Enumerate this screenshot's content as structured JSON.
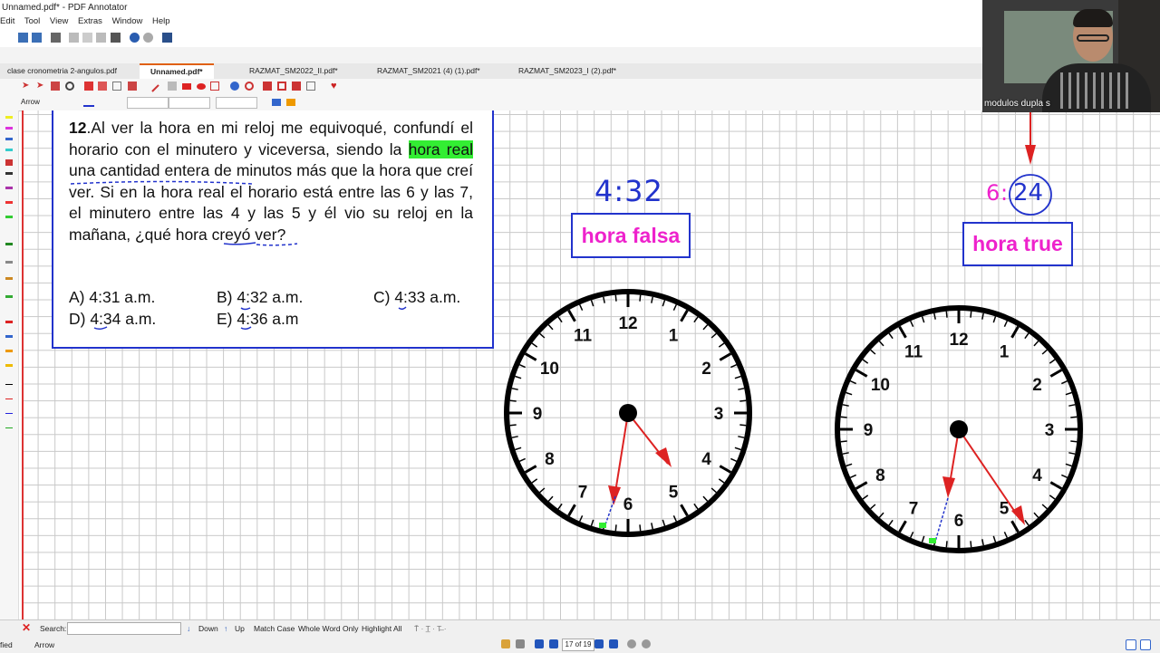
{
  "window": {
    "title": "Unnamed.pdf* - PDF Annotator"
  },
  "menu": [
    "Edit",
    "Tool",
    "View",
    "Extras",
    "Window",
    "Help"
  ],
  "tabs": [
    {
      "label": "clase cronometria 2-angulos.pdf",
      "active": false
    },
    {
      "label": "Unnamed.pdf*",
      "active": true
    },
    {
      "label": "RAZMAT_SM2022_II.pdf*",
      "active": false
    },
    {
      "label": "RAZMAT_SM2021 (4) (1).pdf*",
      "active": false
    },
    {
      "label": "RAZMAT_SM2023_I (2).pdf*",
      "active": false
    }
  ],
  "toolbar": {
    "current_tool": "Arrow"
  },
  "question": {
    "number": "12",
    "text_part1": ".Al ver la hora en mi reloj me equivoqué, confundí el horario con el minutero y viceversa, siendo la ",
    "highlight": "hora real",
    "text_part2": " una cantidad entera de minutos más que la hora que creí ver. Si en la hora real el horario está entre las 6 y las 7, el minutero entre las 4 y las 5 y él vio su reloj en la mañana, ¿qué hora creyó ver?",
    "options": {
      "a": "A) 4:31 a.m.",
      "b": "B) 4:32 a.m.",
      "c": "C) 4:33 a.m.",
      "d": "D) 4:34 a.m.",
      "e": "E) 4:36  a.m"
    }
  },
  "annotations": {
    "false_time": "4:32",
    "false_label": "hora falsa",
    "true_hour": "6",
    "true_sep": ":",
    "true_minutes": "24",
    "true_label": "hora true"
  },
  "clock_numbers": [
    "12",
    "1",
    "2",
    "3",
    "4",
    "5",
    "6",
    "7",
    "8",
    "9",
    "10",
    "11"
  ],
  "video": {
    "participant_name": "modulos dupla s"
  },
  "status": {
    "search_label": "Search:",
    "down": "Down",
    "up": "Up",
    "match_case": "Match Case",
    "whole_word": "Whole Word Only",
    "highlight_all": "Highlight All",
    "page_indicator": "17 of 19",
    "left_status": "fied",
    "tool_status": "Arrow"
  },
  "colors": {
    "accent_blue": "#2233cc",
    "magenta": "#ee22cc",
    "red": "#dd2222",
    "highlight": "#33ee33"
  }
}
